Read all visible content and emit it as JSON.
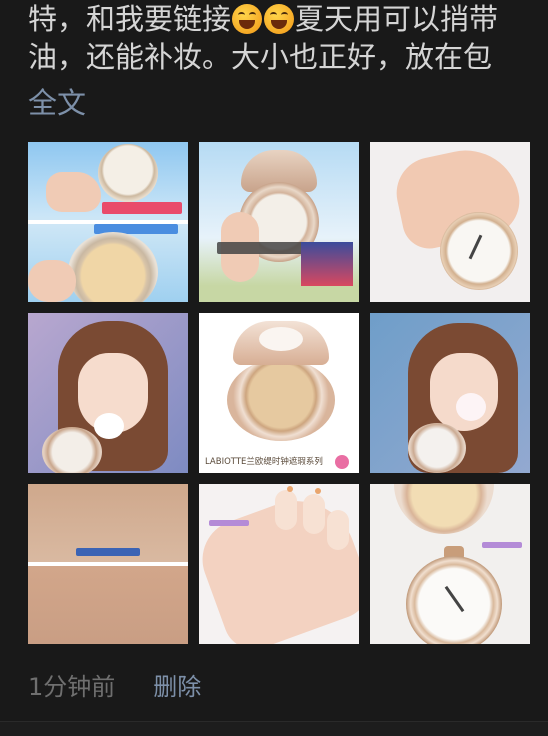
{
  "post": {
    "line1_a": "特，和我要链接",
    "line1_emoji": "squinting-laughing-emoji",
    "line1_b": "夏天用可以捎带",
    "line2": "油，还能补妆。大小也正好，放在包",
    "full_text_label": "全文"
  },
  "images": [
    {
      "alt": "compact-on-sky-collage",
      "caption": "",
      "tags": [
        "pink-banner",
        "blue-banner"
      ]
    },
    {
      "alt": "compact-held-outdoors",
      "caption": ""
    },
    {
      "alt": "hand-with-pocket-watch-compact",
      "caption": ""
    },
    {
      "alt": "woman-with-puff-1",
      "caption": ""
    },
    {
      "alt": "labiotte-compact-product-shot",
      "caption": "LABIOTTE兰欧缇时钟遮瑕系列"
    },
    {
      "alt": "woman-with-puff-2",
      "caption": ""
    },
    {
      "alt": "swatch-on-hand",
      "caption": ""
    },
    {
      "alt": "fingertips-swatch",
      "caption": ""
    },
    {
      "alt": "open-watch-compact",
      "caption": ""
    }
  ],
  "meta": {
    "timestamp": "1分钟前",
    "delete_label": "删除"
  },
  "colors": {
    "background": "#191919",
    "text": "#d5d5d5",
    "link": "#7d90a9",
    "muted": "#6f6f6f"
  }
}
